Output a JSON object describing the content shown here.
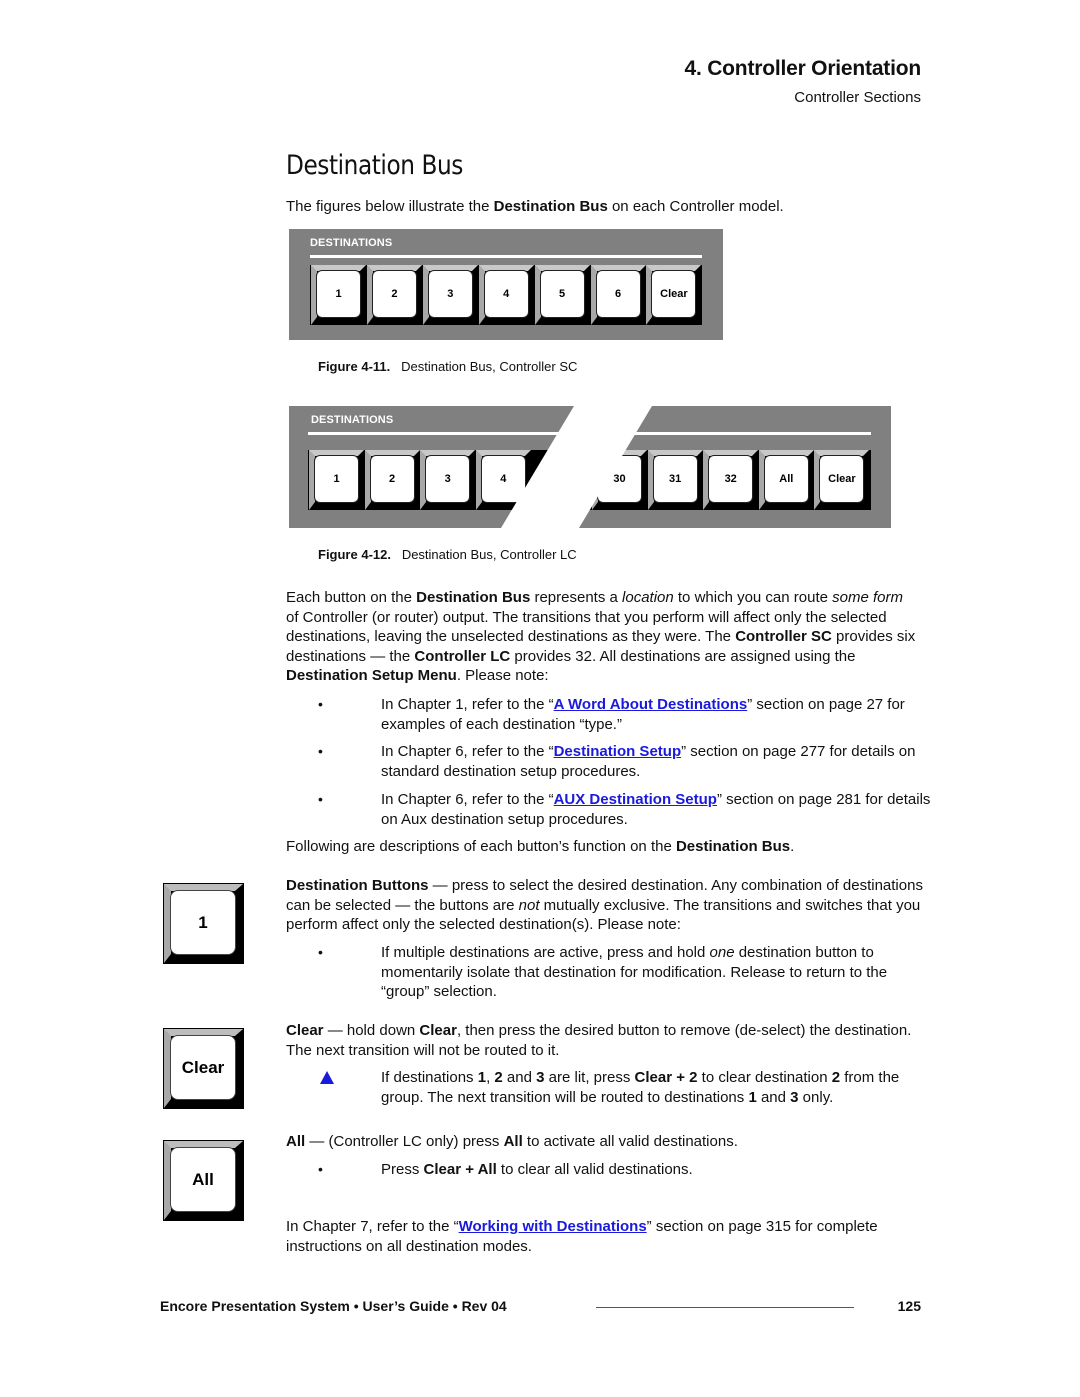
{
  "header": {
    "chapter_title": "4.  Controller Orientation",
    "section": "Controller Sections"
  },
  "page_heading": "Destination Bus",
  "intro": {
    "t1": "The figures below illustrate the ",
    "b1": "Destination Bus",
    "t2": " on each Controller model."
  },
  "figure_sc": {
    "panel_label": "DESTINATIONS",
    "keys": [
      "1",
      "2",
      "3",
      "4",
      "5",
      "6",
      "Clear"
    ],
    "caption_label": "Figure 4-11.",
    "caption_text": "Destination Bus, Controller SC"
  },
  "figure_lc": {
    "panel_label": "DESTINATIONS",
    "keys_left": [
      "1",
      "2",
      "3",
      "4"
    ],
    "keys_right": [
      "30",
      "31",
      "32",
      "All",
      "Clear"
    ],
    "caption_label": "Figure 4-12.",
    "caption_text": "Destination Bus, Controller LC"
  },
  "body": {
    "p1": {
      "t1": "Each button on the ",
      "b1": "Destination Bus",
      "t2": " represents a ",
      "i1": "location",
      "t3": " to which you can route ",
      "i2": "some form",
      "t4": " of Controller (or router) output.  The transitions that you perform will affect only the selected destinations, leaving the unselected destinations as they were.  The ",
      "b2": "Controller SC",
      "t5": " provides six destinations — the ",
      "b3": "Controller LC",
      "t6": " provides 32.  All destinations are assigned using the ",
      "b4": "Destination Setup Menu",
      "t7": ".  Please note:"
    },
    "bullets": [
      {
        "pre": "In Chapter 1, refer to the “",
        "link": "A Word About Destinations",
        "post": "” section on page 27 for examples of each destination “type.”"
      },
      {
        "pre": "In Chapter 6, refer to the “",
        "link": "Destination Setup",
        "post": "” section on page 277 for details on standard destination setup procedures."
      },
      {
        "pre": "In Chapter 6, refer to the “",
        "link": "AUX Destination Setup",
        "post": "” section on page 281 for details on Aux destination setup procedures."
      }
    ],
    "p2": {
      "t1": "Following are descriptions of each button’s function on the ",
      "b1": "Destination Bus",
      "t2": "."
    },
    "dest_buttons": {
      "key_label": "1",
      "b1": "Destination Buttons",
      "t1": " — press to select the desired destination.  Any combination of destinations can be selected — the buttons are ",
      "i1": "not",
      "t2": " mutually exclusive.  The transitions and switches that you perform affect only the selected destination(s).  Please note:",
      "bullet_t1": "If multiple destinations are active, press and hold ",
      "bullet_i1": "one",
      "bullet_t2": " destination button to momentarily isolate that destination for modification.  Release to return to the “group” selection."
    },
    "clear": {
      "key_label": "Clear",
      "b1": "Clear",
      "t1": " — hold down ",
      "b2": "Clear",
      "t2": ", then press the desired button to remove (de-select) the destination.  The next transition will not be routed to it.",
      "note_t1": "If destinations ",
      "note_b1": "1",
      "note_t2": ", ",
      "note_b2": "2",
      "note_t3": " and ",
      "note_b3": "3",
      "note_t4": " are lit, press ",
      "note_b4": "Clear + 2",
      "note_t5": " to clear destination ",
      "note_b5": "2",
      "note_t6": " from the group.  The next transition will be routed to destinations ",
      "note_b6": "1",
      "note_t7": " and ",
      "note_b7": "3",
      "note_t8": " only."
    },
    "all": {
      "key_label": "All",
      "b1": "All",
      "t1": " — (Controller LC only) press ",
      "b2": "All",
      "t2": " to activate all valid destinations.",
      "bullet_t1": "Press ",
      "bullet_b1": "Clear + All",
      "bullet_t2": " to clear all valid destinations."
    },
    "final": {
      "pre": "In Chapter 7, refer to the “",
      "link": "Working with Destinations",
      "post": "” section on page 315 for complete instructions on all destination modes."
    }
  },
  "footer": {
    "text": "Encore Presentation System  •  User’s Guide  •  Rev 04",
    "page_number": "125"
  },
  "colors": {
    "link": "#1a1adc",
    "panel": "#808080"
  }
}
